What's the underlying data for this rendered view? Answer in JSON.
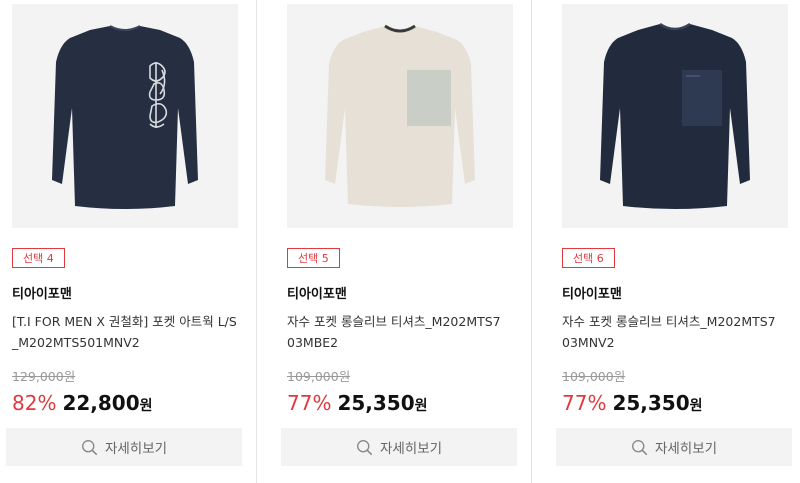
{
  "products": [
    {
      "badge": "선택 4",
      "brand": "티아이포맨",
      "name_line1": "[T.I FOR MEN X 권철화] 포켓 아트웍 L/S",
      "name_line2": "_M202MTS501MNV2",
      "original_price": "129,000원",
      "discount": "82%",
      "price": "22,800",
      "currency": "원",
      "detail_label": "자세히보기",
      "shirt_color": "#262f42",
      "pocket_color": "#262f42",
      "graphic": "artwork-print"
    },
    {
      "badge": "선택 5",
      "brand": "티아이포맨",
      "name_line1": "자수 포켓 롱슬리브 티셔츠_M202MTS7",
      "name_line2": "03MBE2",
      "original_price": "109,000원",
      "discount": "77%",
      "price": "25,350",
      "currency": "원",
      "detail_label": "자세히보기",
      "shirt_color": "#e6e0d6",
      "pocket_color": "#c9cfc7",
      "graphic": "pocket"
    },
    {
      "badge": "선택 6",
      "brand": "티아이포맨",
      "name_line1": "자수 포켓 롱슬리브 티셔츠_M202MTS7",
      "name_line2": "03MNV2",
      "original_price": "109,000원",
      "discount": "77%",
      "price": "25,350",
      "currency": "원",
      "detail_label": "자세히보기",
      "shirt_color": "#222b3d",
      "pocket_color": "#2e3a52",
      "graphic": "pocket"
    }
  ],
  "colors": {
    "accent": "#e0393e",
    "strike": "#999999",
    "button_bg": "#f3f3f3"
  }
}
